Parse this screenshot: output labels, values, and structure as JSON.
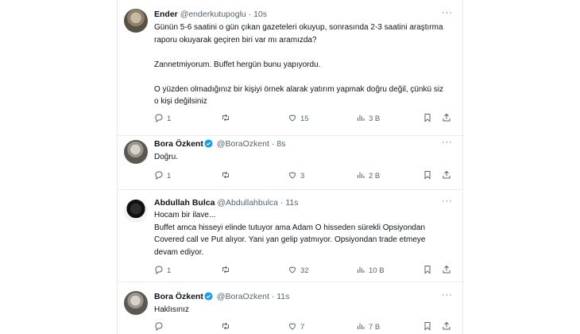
{
  "tweets": [
    {
      "name": "Ender",
      "handle": "@enderkutupoglu",
      "sep": "·",
      "time": "10s",
      "verified": false,
      "more": "···",
      "body": "Günün  5-6 saatini o gün çıkan gazeteleri okuyup, sonrasında 2-3 saatini araştırma raporu okuyarak geçiren biri var mı aramızda?\n\nZannetmiyorum. Buffet hergün bunu yapıyordu.\n\nO yüzden olmadığınız bir kişiyi örnek alarak yatırım yapmak doğru değil, çünkü siz o kişi değilsiniz",
      "replies": "1",
      "retweets": "",
      "likes": "15",
      "views": "3 B"
    },
    {
      "name": "Bora Özkent",
      "handle": "@BoraOzkent",
      "sep": "·",
      "time": "8s",
      "verified": true,
      "more": "···",
      "body": "Doğru.",
      "replies": "1",
      "retweets": "",
      "likes": "3",
      "views": "2 B"
    },
    {
      "name": "Abdullah Bulca",
      "handle": "@Abdullahbulca",
      "sep": "·",
      "time": "11s",
      "verified": false,
      "more": "···",
      "body": "Hocam bir ilave...\nBuffet amca hisseyi elinde tutuyor ama Adam O hisseden sürekli Opsiyondan Covered call ve Put alıyor. Yani yan gelip yatmıyor. Opsiyondan trade etmeye devam ediyor.",
      "replies": "1",
      "retweets": "",
      "likes": "32",
      "views": "10 B"
    },
    {
      "name": "Bora Özkent",
      "handle": "@BoraOzkent",
      "sep": "·",
      "time": "11s",
      "verified": true,
      "more": "···",
      "body": "Haklısınız",
      "replies": "",
      "retweets": "",
      "likes": "7",
      "views": "7 B"
    }
  ],
  "colors": {
    "text": "#0f1419",
    "muted": "#536471",
    "verified": "#1d9bf0",
    "divider": "#e8ebed"
  },
  "icons": [
    "reply-icon",
    "retweet-icon",
    "like-icon",
    "views-icon",
    "bookmark-icon",
    "share-icon",
    "verified-badge-icon"
  ]
}
